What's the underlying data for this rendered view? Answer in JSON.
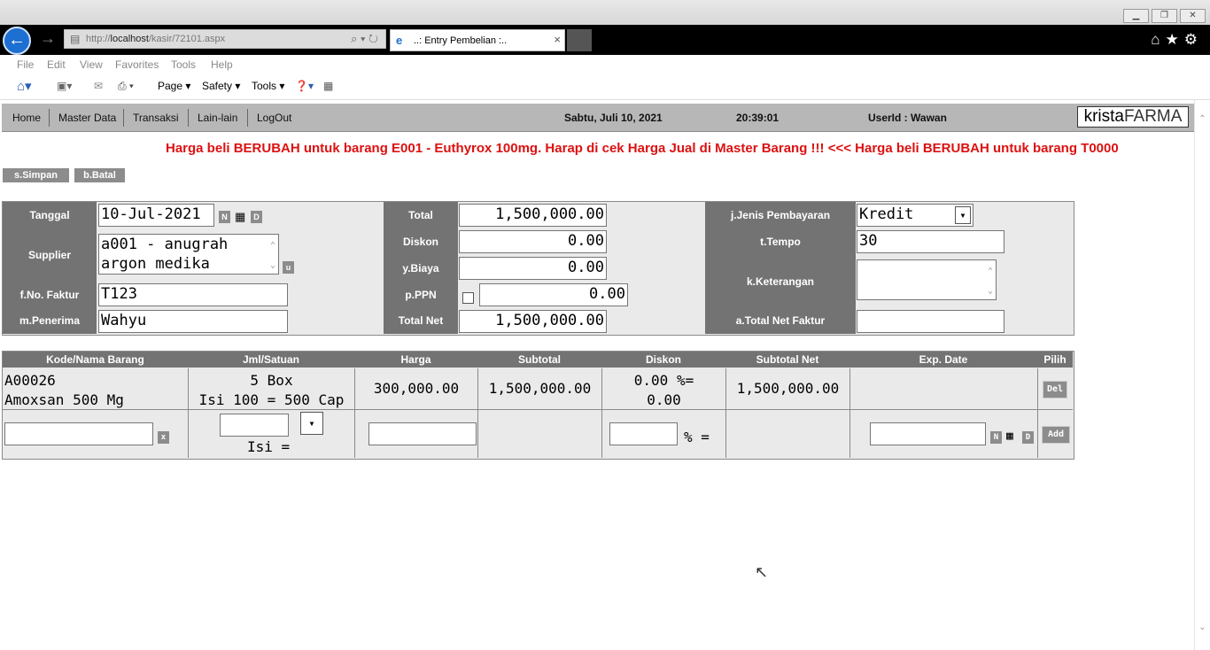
{
  "browser": {
    "url_prefix": "http://",
    "url_host": "localhost",
    "url_path": "/kasir/72101.aspx",
    "tab_title": "..: Entry Pembelian :..",
    "menu": [
      "File",
      "Edit",
      "View",
      "Favorites",
      "Tools",
      "Help"
    ],
    "command_bar": [
      "Page ▾",
      "Safety ▾",
      "Tools ▾"
    ]
  },
  "app": {
    "nav": [
      "Home",
      "Master Data",
      "Transaksi",
      "Lain-lain",
      "LogOut"
    ],
    "date": "Sabtu, Juli 10, 2021",
    "time": "20:39:01",
    "user": "UserId : Wawan",
    "logo_a": "krista",
    "logo_b": "FARMA",
    "marquee": "Harga beli BERUBAH untuk barang E001 - Euthyrox 100mg. Harap di cek Harga Jual di Master Barang !!!   <<<   Harga beli BERUBAH untuk barang T0000",
    "btn_simpan": "s.Simpan",
    "btn_batal": "b.Batal"
  },
  "form": {
    "tanggal_label": "Tanggal",
    "tanggal": "10-Jul-2021",
    "supplier_label": "Supplier",
    "supplier_line1": "a001 - anugrah",
    "supplier_line2": "argon medika",
    "faktur_label": "f.No. Faktur",
    "faktur": "T123",
    "penerima_label": "m.Penerima",
    "penerima": "Wahyu",
    "total_label": "Total",
    "total": "1,500,000.00",
    "diskon_label": "Diskon",
    "diskon": "0.00",
    "biaya_label": "y.Biaya",
    "biaya": "0.00",
    "ppn_label": "p.PPN",
    "ppn": "0.00",
    "totalnet_label": "Total Net",
    "totalnet": "1,500,000.00",
    "jenis_label": "j.Jenis Pembayaran",
    "jenis": "Kredit",
    "tempo_label": "t.Tempo",
    "tempo": "30",
    "keterangan_label": "k.Keterangan",
    "keterangan": "",
    "totalfaktur_label": "a.Total Net Faktur",
    "totalfaktur": "",
    "btn_n": "N",
    "btn_d": "D",
    "btn_u": "u"
  },
  "grid": {
    "headers": [
      "Kode/Nama Barang",
      "Jml/Satuan",
      "Harga",
      "Subtotal",
      "Diskon",
      "Subtotal Net",
      "Exp. Date",
      "Pilih"
    ],
    "row": {
      "kode": "A00026",
      "nama": "Amoxsan 500 Mg",
      "jml": "5 Box",
      "isi": "Isi 100 = 500 Cap",
      "harga": "300,000.00",
      "subtotal": "1,500,000.00",
      "diskon_pct": "0.00 %=",
      "diskon_val": "0.00",
      "subtotal_net": "1,500,000.00",
      "exp": "",
      "del": "Del"
    },
    "entry": {
      "isi_label": "Isi =",
      "pct_label": "% =",
      "x": "x",
      "add": "Add"
    }
  }
}
